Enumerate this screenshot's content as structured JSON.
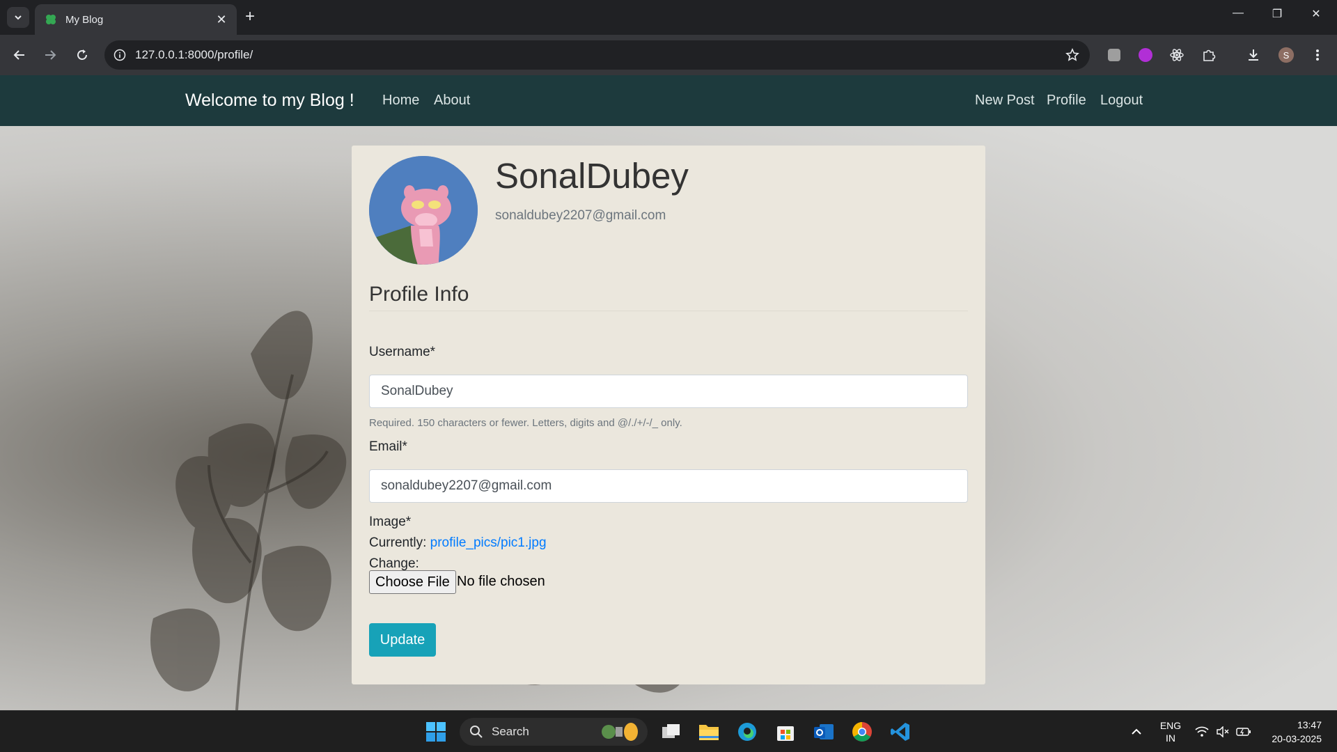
{
  "browser": {
    "tab_title": "My Blog",
    "url": "127.0.0.1:8000/profile/",
    "profile_initial": "S"
  },
  "site": {
    "brand": "Welcome to my Blog !",
    "nav_left": [
      "Home",
      "About"
    ],
    "nav_right": [
      "New Post",
      "Profile",
      "Logout"
    ],
    "navbar_color": "#1d3a3d"
  },
  "profile": {
    "username": "SonalDubey",
    "email": "sonaldubey2207@gmail.com",
    "legend": "Profile Info",
    "form": {
      "username_label": "Username*",
      "username_value": "SonalDubey",
      "username_help": "Required. 150 characters or fewer. Letters, digits and @/./+/-/_ only.",
      "email_label": "Email*",
      "email_value": "sonaldubey2207@gmail.com",
      "image_label": "Image*",
      "currently_label": "Currently:",
      "current_file": "profile_pics/pic1.jpg",
      "change_label": "Change:",
      "choose_file_label": "Choose File",
      "no_file_text": "No file chosen",
      "submit_label": "Update",
      "submit_color": "#17a2b8"
    }
  },
  "taskbar": {
    "search_label": "Search",
    "lang_top": "ENG",
    "lang_bottom": "IN",
    "time": "13:47",
    "date": "20-03-2025"
  }
}
